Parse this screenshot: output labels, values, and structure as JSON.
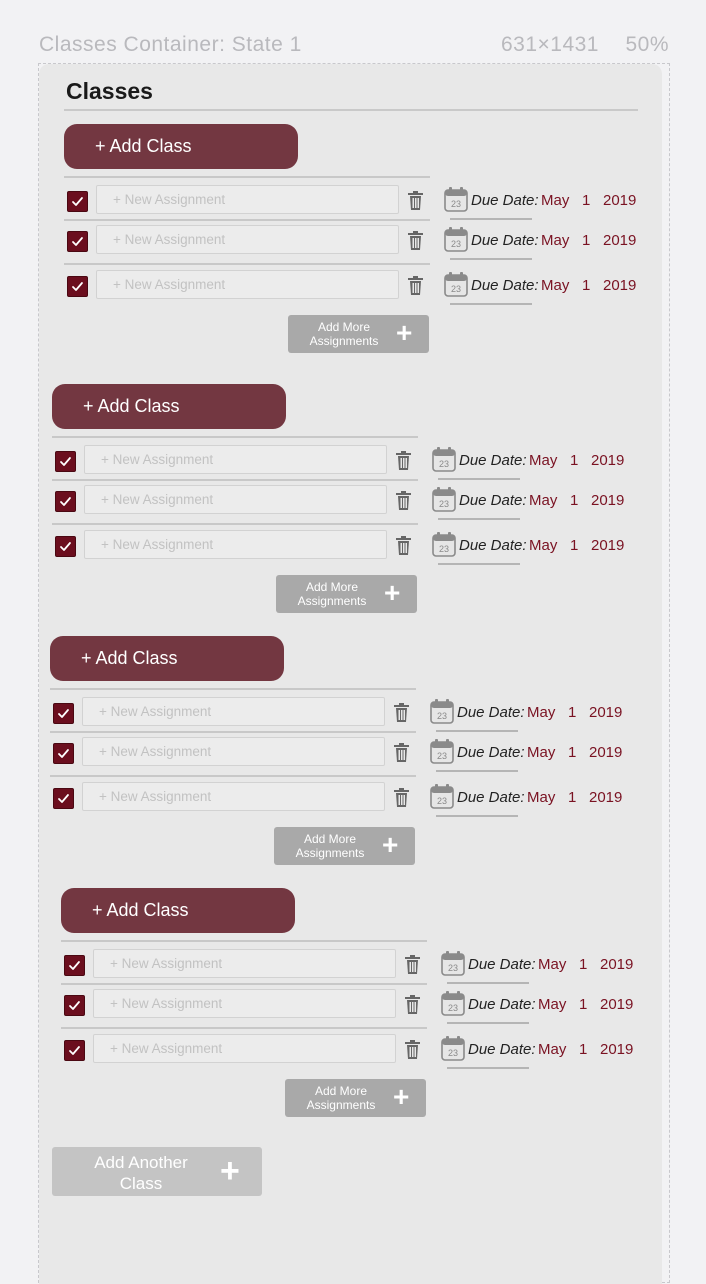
{
  "canvas": {
    "name": "Classes Container: State 1",
    "size": "631×1431",
    "zoom": "50%"
  },
  "title": "Classes",
  "add_class_label": "+ Add Class",
  "assignment_placeholder": "+ New Assignment",
  "due_label": "Due Date:",
  "due_month": "May",
  "due_day": "1",
  "due_year": "2019",
  "calendar_day": "23",
  "add_more": {
    "line1": "Add More",
    "line2": "Assignments",
    "icon": "+"
  },
  "add_another": {
    "line1": "Add Another",
    "line2": "Class",
    "icon": "+"
  },
  "colors": {
    "accent": "#733741",
    "checkbox": "#6b0e1e",
    "date_text": "#7a1222",
    "secondary_button": "#a9a9a9",
    "panel": "#e8e8e8"
  },
  "classes": [
    {
      "assignments": [
        {
          "checked": true
        },
        {
          "checked": true
        },
        {
          "checked": true
        }
      ]
    },
    {
      "assignments": [
        {
          "checked": true
        },
        {
          "checked": true
        },
        {
          "checked": true
        }
      ]
    },
    {
      "assignments": [
        {
          "checked": true
        },
        {
          "checked": true
        },
        {
          "checked": true
        }
      ]
    },
    {
      "assignments": [
        {
          "checked": true
        },
        {
          "checked": true
        },
        {
          "checked": true
        }
      ]
    }
  ]
}
